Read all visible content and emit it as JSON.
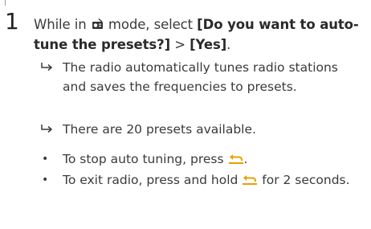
{
  "step": {
    "number": "1",
    "text_before_icon": "While in",
    "mode_icon": "radio-mode-icon",
    "text_after_icon": "mode, select",
    "option_1": "[Do you want to auto-tune the presets?]",
    "separator": ">",
    "option_2": "[Yes]",
    "end": "."
  },
  "results": [
    {
      "icon": "result-arrow-icon",
      "text": "The radio automatically tunes radio stations and saves the frequencies to presets."
    },
    {
      "icon": "result-arrow-icon",
      "text": "There are 20 presets available."
    }
  ],
  "bullets": [
    {
      "text_before": "To stop auto tuning, press",
      "icon": "back-icon",
      "text_after": "."
    },
    {
      "text_before": "To exit radio, press and hold",
      "icon": "back-icon",
      "text_after": "for 2 seconds."
    }
  ],
  "colors": {
    "text": "#3a3a3a",
    "back_icon": "#e8a000"
  }
}
